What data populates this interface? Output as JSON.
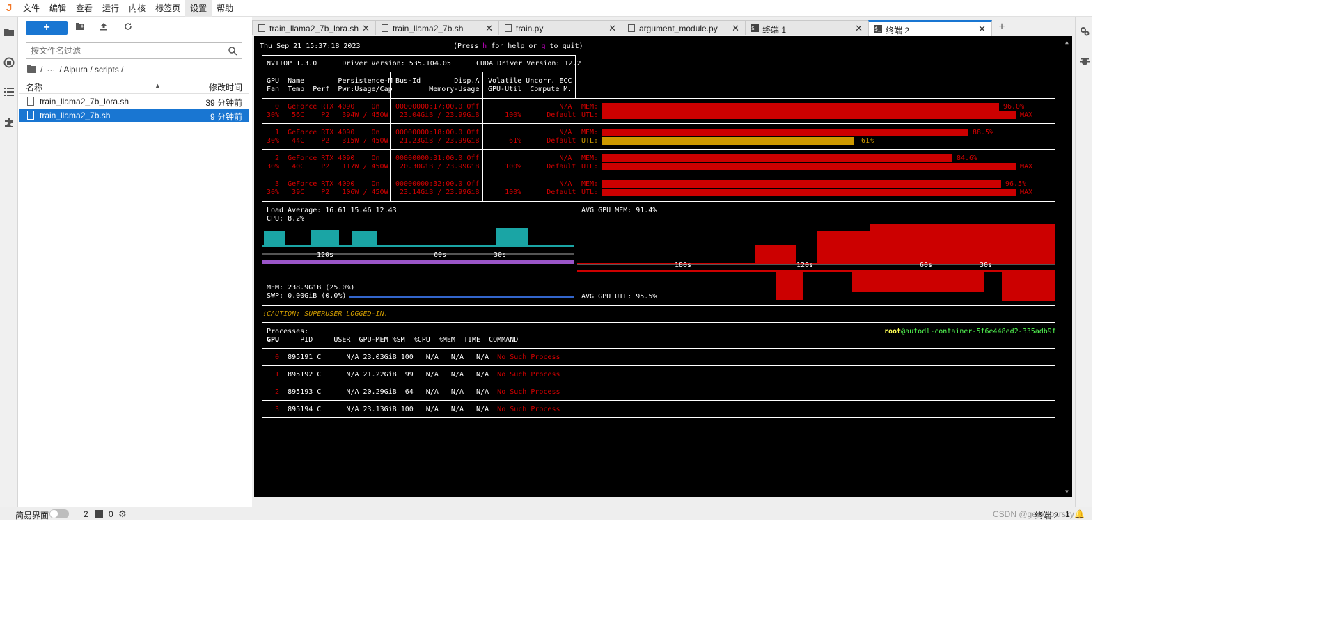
{
  "menu": {
    "logo": "J",
    "items": [
      "文件",
      "编辑",
      "查看",
      "运行",
      "内核",
      "标签页",
      "设置",
      "帮助"
    ]
  },
  "filebrowser": {
    "new_label": "+",
    "search_placeholder": "按文件名过滤",
    "breadcrumb": {
      "root": "/",
      "ellipsis": "···",
      "path1": "/ Aipura / scripts /"
    },
    "col_name": "名称",
    "col_modified": "修改时间",
    "files": [
      {
        "name": "train_llama2_7b_lora.sh",
        "modified": "39 分钟前"
      },
      {
        "name": "train_llama2_7b.sh",
        "modified": "9 分钟前"
      }
    ]
  },
  "tabs": [
    {
      "label": "train_llama2_7b_lora.sh",
      "kind": "file"
    },
    {
      "label": "train_llama2_7b.sh",
      "kind": "file"
    },
    {
      "label": "train.py",
      "kind": "file"
    },
    {
      "label": "argument_module.py",
      "kind": "file"
    },
    {
      "label": "终端 1",
      "kind": "terminal"
    },
    {
      "label": "终端 2",
      "kind": "terminal"
    }
  ],
  "terminal": {
    "datetime": "Thu Sep 21 15:37:18 2023",
    "help_prefix": "(Press ",
    "help_h": "h",
    "help_mid": " for help or ",
    "help_q": "q",
    "help_suffix": " to quit)",
    "header_line": "NVITOP 1.3.0      Driver Version: 535.104.05      CUDA Driver Version: 12.2",
    "col_hdr1a": "GPU  Name        Persistence-M",
    "col_hdr1b": "Fan  Temp  Perf  Pwr:Usage/Cap",
    "col_hdr2a": "Bus-Id        Disp.A",
    "col_hdr2b": "        Memory-Usage",
    "col_hdr3a": "Volatile Uncorr. ECC",
    "col_hdr3b": "GPU-Util  Compute M.",
    "gpus": [
      {
        "l1a": "  0  GeForce RTX 4090    On",
        "l1b": "30%   56C    P2   394W / 450W",
        "l2a": "00000000:17:00.0 Off",
        "l2b": " 23.04GiB / 23.99GiB",
        "l3a": "                 N/A",
        "l3b": "    100%      Default",
        "mem_label": "MEM:",
        "mem_pct": "96.0%",
        "util_label": "UTL:",
        "util_pct": "MAX"
      },
      {
        "l1a": "  1  GeForce RTX 4090    On",
        "l1b": "30%   44C    P2   315W / 450W",
        "l2a": "00000000:18:00.0 Off",
        "l2b": " 21.23GiB / 23.99GiB",
        "l3a": "                 N/A",
        "l3b": "     61%      Default",
        "mem_label": "MEM:",
        "mem_pct": "88.5%",
        "util_label": "UTL:",
        "util_pct": "61%"
      },
      {
        "l1a": "  2  GeForce RTX 4090    On",
        "l1b": "30%   40C    P2   117W / 450W",
        "l2a": "00000000:31:00.0 Off",
        "l2b": " 20.30GiB / 23.99GiB",
        "l3a": "                 N/A",
        "l3b": "    100%      Default",
        "mem_label": "MEM:",
        "mem_pct": "84.6%",
        "util_label": "UTL:",
        "util_pct": "MAX"
      },
      {
        "l1a": "  3  GeForce RTX 4090    On",
        "l1b": "30%   39C    P2   106W / 450W",
        "l2a": "00000000:32:00.0 Off",
        "l2b": " 23.14GiB / 23.99GiB",
        "l3a": "                 N/A",
        "l3b": "    100%      Default",
        "mem_label": "MEM:",
        "mem_pct": "96.5%",
        "util_label": "UTL:",
        "util_pct": "MAX"
      }
    ],
    "bars": [
      {
        "mem": 0.96,
        "util": 1.0,
        "util_color": "#cc0000"
      },
      {
        "mem": 0.885,
        "util": 0.61,
        "util_color": "#cc9900"
      },
      {
        "mem": 0.846,
        "util": 1.0,
        "util_color": "#cc0000"
      },
      {
        "mem": 0.965,
        "util": 1.0,
        "util_color": "#cc0000"
      }
    ],
    "load_average": "Load Average: 16.61 15.46 12.43",
    "cpu": "CPU: 8.2%",
    "mem": "MEM: 238.9GiB (25.0%)",
    "swp": "SWP: 0.00GiB (0.0%)",
    "avg_gpu_mem": "AVG GPU MEM: 91.4%",
    "avg_gpu_util": "AVG GPU UTL: 95.5%",
    "timeline_left": [
      "120s",
      "60s",
      "30s"
    ],
    "timeline_right": [
      "180s",
      "120s",
      "60s",
      "30s"
    ],
    "caution": "!CAUTION: SUPERUSER LOGGED-IN.",
    "processes_label": "Processes:",
    "host_user": "root",
    "host_name": "@autodl-container-5f6e448ed2-335adb9f",
    "proc_header_gpu": "GPU",
    "proc_header_rest": "     PID     USER  GPU-MEM %SM  %CPU  %MEM  TIME  COMMAND",
    "procs": [
      {
        "gpu": "0",
        "pid": "895191 C",
        "stats": "N/A 23.03GiB 100   N/A   N/A   N/A",
        "cmd": "No Such Process"
      },
      {
        "gpu": "1",
        "pid": "895192 C",
        "stats": "N/A 21.22GiB  99   N/A   N/A   N/A",
        "cmd": "No Such Process"
      },
      {
        "gpu": "2",
        "pid": "895193 C",
        "stats": "N/A 20.29GiB  64   N/A   N/A   N/A",
        "cmd": "No Such Process"
      },
      {
        "gpu": "3",
        "pid": "895194 C",
        "stats": "N/A 23.13GiB 100   N/A   N/A   N/A",
        "cmd": "No Such Process"
      }
    ]
  },
  "statusbar": {
    "simple_mode": "简易界面",
    "kernels": "2",
    "terminals": "0",
    "watermark": "CSDN @geeksoarsky",
    "right_label": "终端 2",
    "right_num": "1"
  },
  "colors": {
    "accent": "#1976d2",
    "danger": "#cc0000",
    "warn": "#cc9900",
    "terminal_bg": "#000000"
  }
}
